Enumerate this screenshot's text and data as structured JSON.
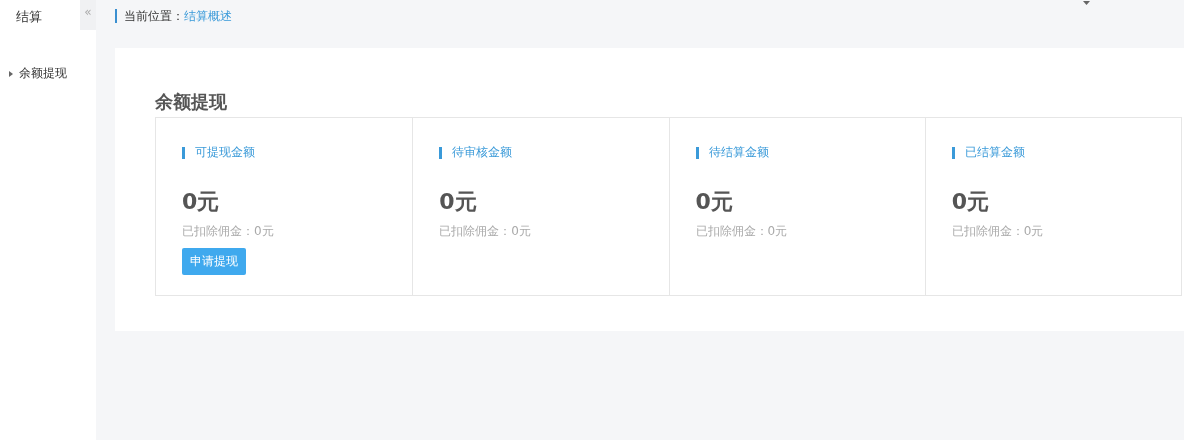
{
  "sidebar": {
    "title": "结算",
    "collapse": "«",
    "items": [
      {
        "label": "余额提现",
        "expanded": false
      }
    ]
  },
  "breadcrumb": {
    "label": "当前位置：",
    "current": "结算概述"
  },
  "section": {
    "title": "余额提现",
    "cards": [
      {
        "title": "可提现金额",
        "amount": "0元",
        "note": "已扣除佣金：0元",
        "button": "申请提现"
      },
      {
        "title": "待审核金额",
        "amount": "0元",
        "note": "已扣除佣金：0元"
      },
      {
        "title": "待结算金额",
        "amount": "0元",
        "note": "已扣除佣金：0元"
      },
      {
        "title": "已结算金额",
        "amount": "0元",
        "note": "已扣除佣金：0元"
      }
    ]
  }
}
